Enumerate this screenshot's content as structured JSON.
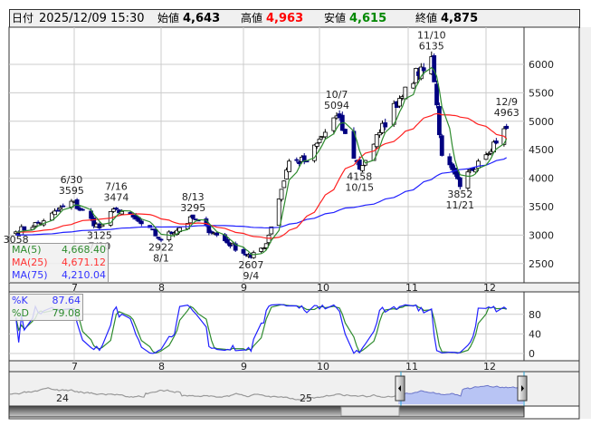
{
  "header": {
    "date_label": "日付",
    "date": "2025/12/09 15:30",
    "open_label": "始値",
    "open": "4,643",
    "high_label": "高値",
    "high": "4,963",
    "low_label": "安値",
    "low": "4,615",
    "close_label": "終値",
    "close": "4,875"
  },
  "colors": {
    "up_border": "#000000",
    "down_fill": "#000080",
    "ma5": "#2e8b2e",
    "ma25": "#ff2020",
    "ma75": "#2020ff",
    "k": "#2020ff",
    "d": "#2e8b2e",
    "high_value": "#ff0000",
    "low_value": "#008000"
  },
  "legend_ma": [
    {
      "name": "MA(5)",
      "value": "4,668.40"
    },
    {
      "name": "MA(25)",
      "value": "4,671.12"
    },
    {
      "name": "MA(75)",
      "value": "4,210.04"
    }
  ],
  "legend_stoch": [
    {
      "name": "%K",
      "value": "87.64"
    },
    {
      "name": "%D",
      "value": "79.08"
    }
  ],
  "navigator": {
    "year_labels": [
      "24",
      "25"
    ]
  },
  "chart_data": {
    "type": "candlestick",
    "y_ticks": [
      "6000",
      "5500",
      "5000",
      "4500",
      "4000",
      "3500",
      "3000",
      "2500"
    ],
    "ylim": [
      2200,
      6600
    ],
    "month_labels": [
      "7",
      "8",
      "9",
      "10",
      "11",
      "12"
    ],
    "stoch_ticks": [
      "80",
      "40",
      "0"
    ],
    "keypoints": [
      [
        "2025-06-10",
        3058
      ],
      [
        "2025-06-20",
        3250
      ],
      [
        "2025-06-30",
        3595
      ],
      [
        "2025-07-10",
        3125
      ],
      [
        "2025-07-16",
        3474
      ],
      [
        "2025-07-25",
        3200
      ],
      [
        "2025-08-01",
        2922
      ],
      [
        "2025-08-13",
        3295
      ],
      [
        "2025-08-25",
        2900
      ],
      [
        "2025-09-04",
        2607
      ],
      [
        "2025-09-10",
        2850
      ],
      [
        "2025-09-19",
        4300
      ],
      [
        "2025-09-26",
        4300
      ],
      [
        "2025-10-07",
        5094
      ],
      [
        "2025-10-15",
        4158
      ],
      [
        "2025-10-22",
        4800
      ],
      [
        "2025-10-31",
        5600
      ],
      [
        "2025-11-10",
        6135
      ],
      [
        "2025-11-14",
        4400
      ],
      [
        "2025-11-21",
        3852
      ],
      [
        "2025-11-28",
        4300
      ],
      [
        "2025-12-09",
        4875
      ]
    ],
    "annotations": [
      {
        "date": "2025-06-10",
        "top": "3058",
        "bottom": "",
        "pos": "below",
        "value": 3058
      },
      {
        "date": "2025-06-30",
        "top": "6/30",
        "bottom": "3595",
        "pos": "above",
        "value": 3595
      },
      {
        "date": "2025-07-10",
        "top": "3125",
        "bottom": "7/10",
        "pos": "below",
        "value": 3125
      },
      {
        "date": "2025-07-16",
        "top": "7/16",
        "bottom": "3474",
        "pos": "above",
        "value": 3474
      },
      {
        "date": "2025-08-01",
        "top": "2922",
        "bottom": "8/1",
        "pos": "below",
        "value": 2922
      },
      {
        "date": "2025-08-13",
        "top": "8/13",
        "bottom": "3295",
        "pos": "above",
        "value": 3295
      },
      {
        "date": "2025-09-04",
        "top": "2607",
        "bottom": "9/4",
        "pos": "below",
        "value": 2607
      },
      {
        "date": "2025-10-07",
        "top": "10/7",
        "bottom": "5094",
        "pos": "above",
        "value": 5094
      },
      {
        "date": "2025-10-15",
        "top": "4158",
        "bottom": "10/15",
        "pos": "below",
        "value": 4158
      },
      {
        "date": "2025-11-10",
        "top": "11/10",
        "bottom": "6135",
        "pos": "above",
        "value": 6135
      },
      {
        "date": "2025-11-21",
        "top": "3852",
        "bottom": "11/21",
        "pos": "below",
        "value": 3852
      },
      {
        "date": "2025-12-09",
        "top": "12/9",
        "bottom": "4963",
        "pos": "above",
        "value": 4963
      }
    ]
  }
}
